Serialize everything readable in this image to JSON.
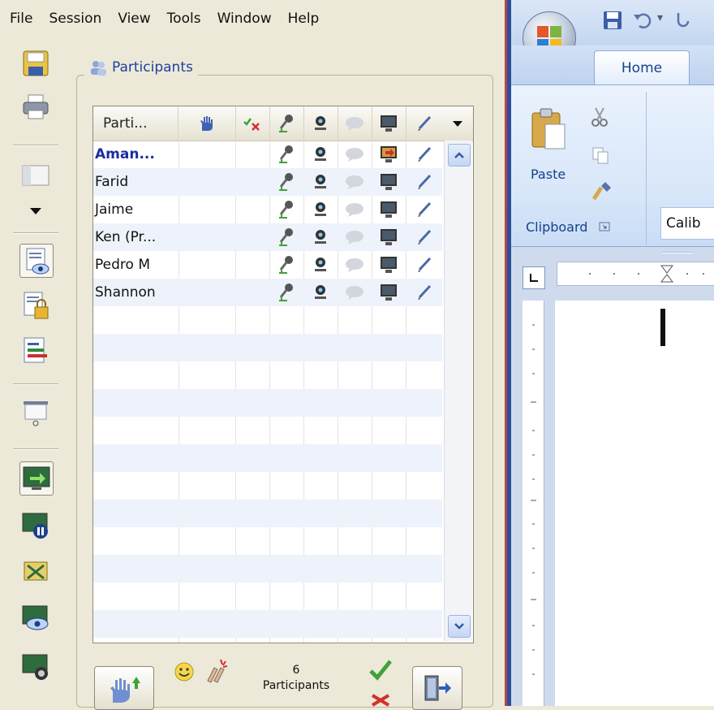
{
  "menubar": {
    "items": [
      "File",
      "Session",
      "View",
      "Tools",
      "Window",
      "Help"
    ]
  },
  "toolbar": {
    "icons": [
      "save-icon",
      "print-icon",
      "layout-icon",
      "dropdown-arrow-icon",
      "view-document-icon",
      "lock-document-icon",
      "document-chart-icon",
      "presentation-icon",
      "share-screen-icon",
      "pause-share-icon",
      "stop-share-icon",
      "view-share-icon",
      "record-share-icon"
    ]
  },
  "participants": {
    "title": "Participants",
    "name_header": "Parti...",
    "column_icons": [
      "raise-hand-icon",
      "check-cross-icon",
      "microphone-icon",
      "webcam-icon",
      "chat-icon",
      "monitor-icon",
      "pen-icon"
    ],
    "rows": [
      {
        "name": "Aman...",
        "bold": true
      },
      {
        "name": "Farid",
        "bold": false
      },
      {
        "name": "Jaime",
        "bold": false
      },
      {
        "name": "Ken (Pr...",
        "bold": false
      },
      {
        "name": "Pedro M",
        "bold": false
      },
      {
        "name": "Shannon",
        "bold": false
      }
    ]
  },
  "footer": {
    "count": "6",
    "count_label": "Participants"
  },
  "word": {
    "home_tab": "Home",
    "paste": "Paste",
    "clipboard": "Clipboard",
    "font_name": "Calib"
  },
  "colors": {
    "accent": "#1f3fa0",
    "ribbon": "#cfdbed",
    "divider_red": "#b94343",
    "divider_blue": "#2e4d9a"
  }
}
